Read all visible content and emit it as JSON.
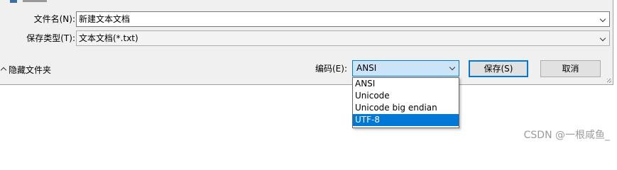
{
  "form": {
    "filename_label": "文件名(N):",
    "filename_value": "新建文本文档",
    "type_label": "保存类型(T):",
    "type_value": "文本文档(*.txt)",
    "encoding_label": "编码(E):",
    "encoding_value": "ANSI"
  },
  "footer": {
    "hide_folders_label": "隐藏文件夹",
    "save_label": "保存(S)",
    "cancel_label": "取消"
  },
  "encoding_options": [
    "ANSI",
    "Unicode",
    "Unicode big endian",
    "UTF-8"
  ],
  "encoding_highlighted": "UTF-8",
  "watermark": "CSDN @一根咸鱼_",
  "colors": {
    "accent": "#0078d7",
    "selected_field_bg": "#cce4f7",
    "dialog_bg": "#f0f0f0"
  }
}
